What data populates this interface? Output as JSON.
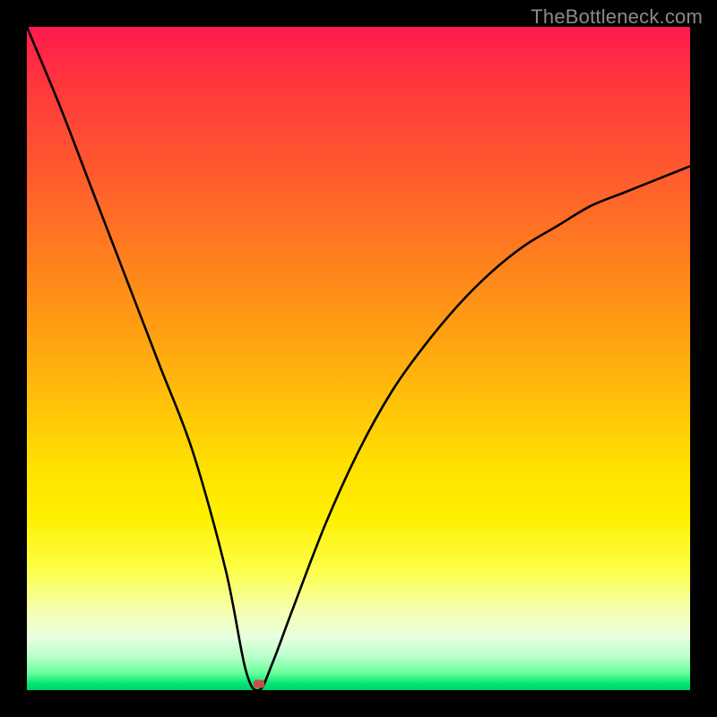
{
  "watermark": "TheBottleneck.com",
  "chart_data": {
    "type": "line",
    "title": "",
    "xlabel": "",
    "ylabel": "",
    "xlim": [
      0,
      100
    ],
    "ylim": [
      0,
      100
    ],
    "grid": false,
    "legend": false,
    "series": [
      {
        "name": "bottleneck-curve",
        "x": [
          0,
          5,
          10,
          15,
          20,
          25,
          30,
          33,
          35,
          37,
          40,
          45,
          50,
          55,
          60,
          65,
          70,
          75,
          80,
          85,
          90,
          95,
          100
        ],
        "y": [
          100,
          88,
          75,
          62,
          49,
          36,
          18,
          3,
          0,
          4,
          12,
          25,
          36,
          45,
          52,
          58,
          63,
          67,
          70,
          73,
          75,
          77,
          79
        ]
      }
    ],
    "annotations": [
      {
        "name": "optimal-marker",
        "x": 35,
        "y": 1
      }
    ],
    "background": {
      "type": "vertical-gradient",
      "stops": [
        {
          "pos": 0.0,
          "color": "#ff1a4d"
        },
        {
          "pos": 0.5,
          "color": "#ffbf0a"
        },
        {
          "pos": 0.8,
          "color": "#fcff4a"
        },
        {
          "pos": 0.97,
          "color": "#66ff99"
        },
        {
          "pos": 1.0,
          "color": "#00d264"
        }
      ]
    }
  }
}
